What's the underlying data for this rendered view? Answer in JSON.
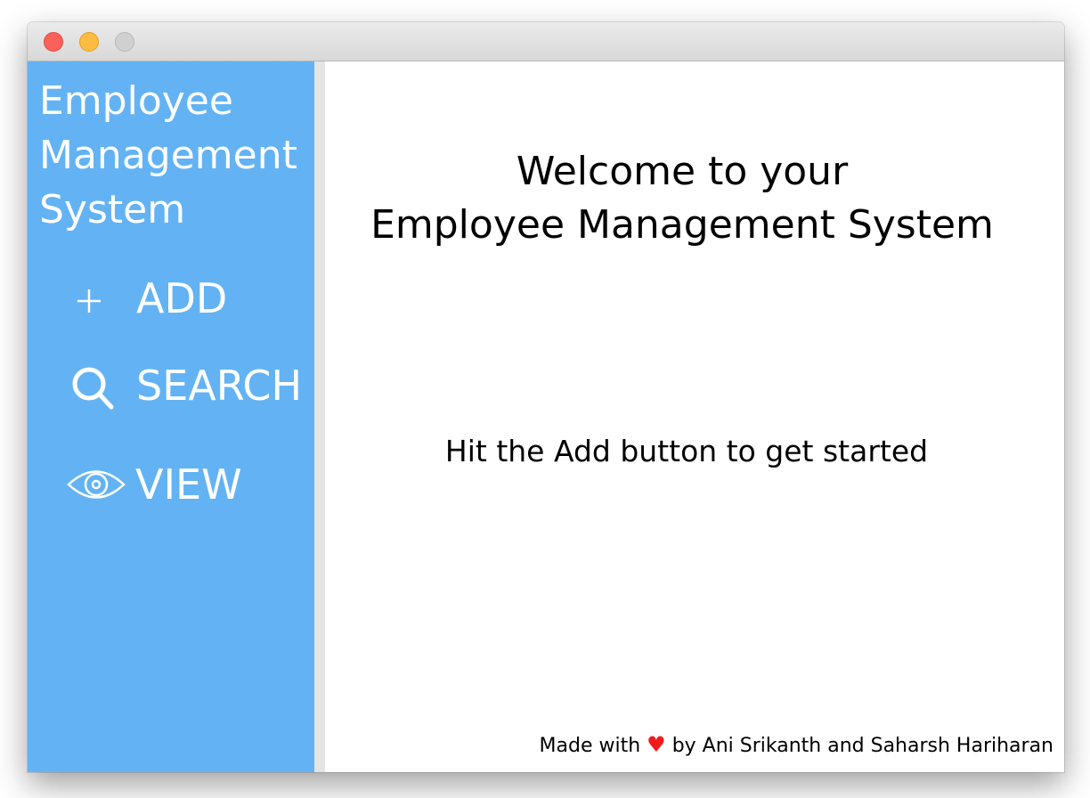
{
  "window": {
    "controls": [
      "close",
      "minimize",
      "zoom"
    ]
  },
  "sidebar": {
    "title": "Employee\nManagement\nSystem",
    "background_color": "#63b3f4",
    "items": [
      {
        "label": "ADD",
        "icon": "plus-icon"
      },
      {
        "label": "SEARCH",
        "icon": "search-icon"
      },
      {
        "label": "VIEW",
        "icon": "eye-icon"
      }
    ]
  },
  "main": {
    "welcome_text": "Welcome to your\nEmployee Management System",
    "hint_text": "Hit the Add button to get started",
    "footer": {
      "prefix": "Made with",
      "heart_icon": "heart-icon",
      "heart_color": "#f21b1b",
      "suffix": "by Ani Srikanth and Saharsh Hariharan"
    }
  }
}
